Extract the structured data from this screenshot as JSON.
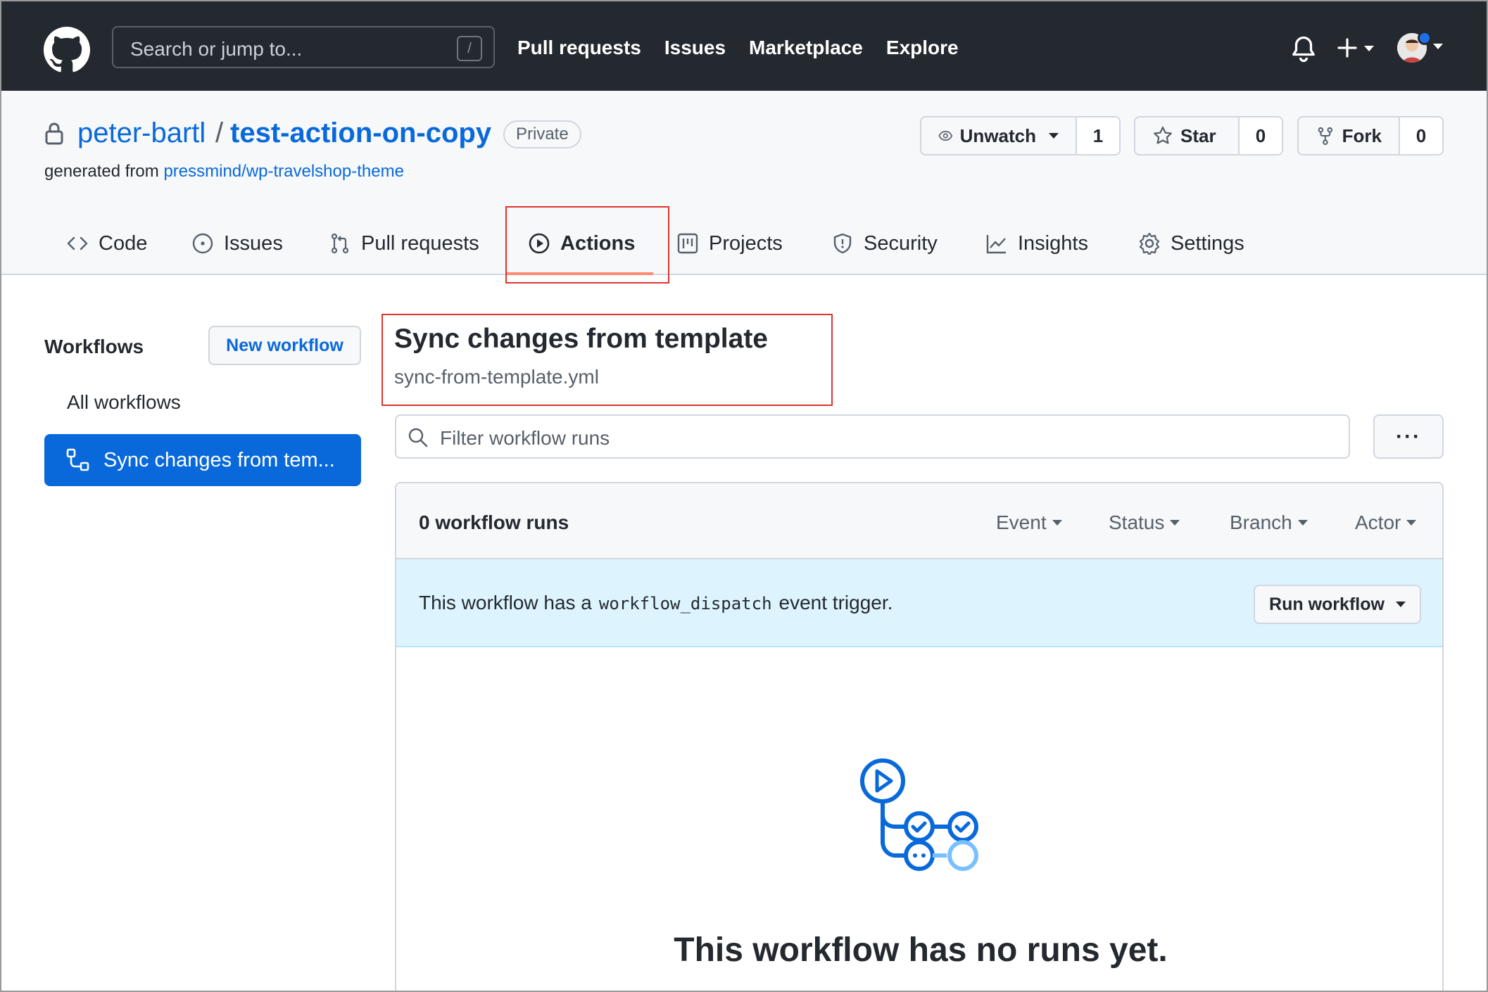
{
  "topbar": {
    "search_placeholder": "Search or jump to...",
    "search_shortcut": "/",
    "nav": [
      "Pull requests",
      "Issues",
      "Marketplace",
      "Explore"
    ]
  },
  "repo": {
    "owner": "peter-bartl",
    "separator": "/",
    "name": "test-action-on-copy",
    "visibility": "Private",
    "generated_prefix": "generated from",
    "generated_source": "pressmind/wp-travelshop-theme",
    "watch": {
      "label": "Unwatch",
      "count": "1"
    },
    "star": {
      "label": "Star",
      "count": "0"
    },
    "fork": {
      "label": "Fork",
      "count": "0"
    }
  },
  "tabs": [
    {
      "label": "Code",
      "icon": "code-icon"
    },
    {
      "label": "Issues",
      "icon": "issue-icon"
    },
    {
      "label": "Pull requests",
      "icon": "pull-request-icon"
    },
    {
      "label": "Actions",
      "icon": "play-icon",
      "active": true
    },
    {
      "label": "Projects",
      "icon": "project-icon"
    },
    {
      "label": "Security",
      "icon": "shield-icon"
    },
    {
      "label": "Insights",
      "icon": "graph-icon"
    },
    {
      "label": "Settings",
      "icon": "gear-icon"
    }
  ],
  "sidebar": {
    "title": "Workflows",
    "new_workflow": "New workflow",
    "all_workflows": "All workflows",
    "selected_workflow": "Sync changes from tem..."
  },
  "main": {
    "title": "Sync changes from template",
    "file": "sync-from-template.yml",
    "filter_placeholder": "Filter workflow runs",
    "more_label": "···",
    "runs_count": "0 workflow runs",
    "filters": [
      "Event",
      "Status",
      "Branch",
      "Actor"
    ],
    "dispatch_prefix": "This workflow has a",
    "dispatch_code": "workflow_dispatch",
    "dispatch_suffix": "event trigger.",
    "run_button": "Run workflow",
    "empty_title": "This workflow has no runs yet."
  },
  "colors": {
    "header_bg": "#24292f",
    "link": "#0969da",
    "highlight": "#e0342c",
    "tab_underline": "#fd8c73",
    "dispatch_bg": "#ddf4ff"
  }
}
